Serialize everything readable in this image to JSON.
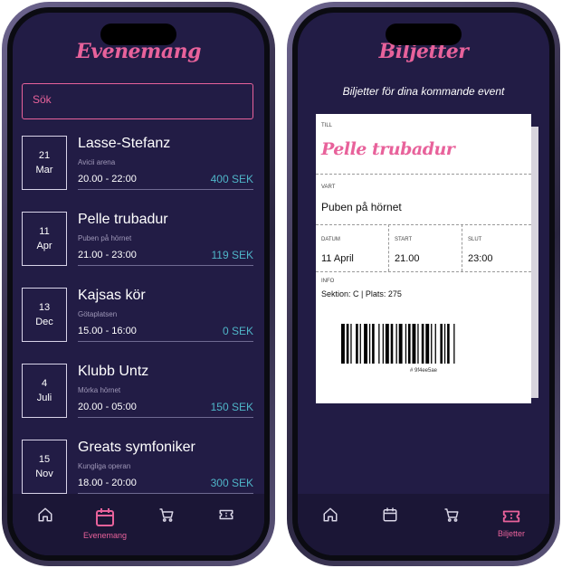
{
  "events_screen": {
    "title": "Evenemang",
    "search_placeholder": "Sök",
    "events": [
      {
        "day": "21",
        "month": "Mar",
        "name": "Lasse-Stefanz",
        "venue": "Avicii arena",
        "time": "20.00 - 22:00",
        "price": "400 SEK"
      },
      {
        "day": "11",
        "month": "Apr",
        "name": "Pelle trubadur",
        "venue": "Puben på hörnet",
        "time": "21.00 - 23:00",
        "price": "119 SEK"
      },
      {
        "day": "13",
        "month": "Dec",
        "name": "Kajsas kör",
        "venue": "Götaplatsen",
        "time": "15.00 - 16:00",
        "price": "0 SEK"
      },
      {
        "day": "4",
        "month": "Juli",
        "name": "Klubb Untz",
        "venue": "Mörka hörnet",
        "time": "20.00 - 05:00",
        "price": "150 SEK"
      },
      {
        "day": "15",
        "month": "Nov",
        "name": "Greats symfoniker",
        "venue": "Kungliga operan",
        "time": "18.00 - 20:00",
        "price": "300 SEK"
      }
    ],
    "tabbar": {
      "active_label": "Evenemang"
    }
  },
  "tickets_screen": {
    "title": "Biljetter",
    "subtitle": "Biljetter för dina kommande event",
    "ticket": {
      "till_label": "TILL",
      "event_name": "Pelle trubadur",
      "vart_label": "VART",
      "venue": "Puben på hörnet",
      "datum_label": "DATUM",
      "date": "11 April",
      "start_label": "START",
      "start": "21.00",
      "slut_label": "SLUT",
      "end": "23:00",
      "info_label": "INFO",
      "info": "Sektion: C | Plats: 275",
      "code": "# 9f4ee5ae"
    },
    "tabbar": {
      "active_label": "Biljetter"
    }
  },
  "colors": {
    "accent": "#e8629b",
    "background": "#221c45",
    "price": "#4fb5c8"
  },
  "icons": [
    "home-icon",
    "calendar-icon",
    "cart-icon",
    "ticket-icon"
  ]
}
